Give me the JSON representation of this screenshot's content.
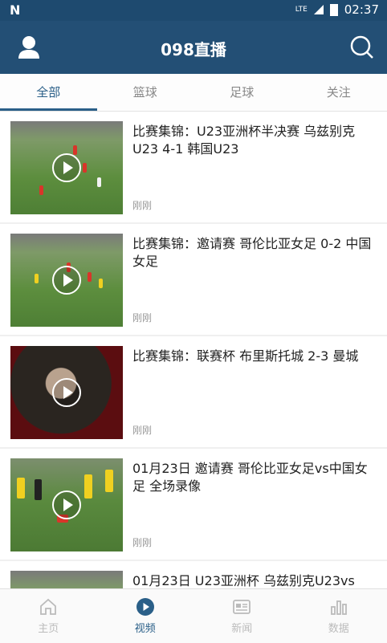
{
  "status": {
    "carrier_icon": "N",
    "network": "LTE",
    "time": "02:37"
  },
  "app": {
    "title": "098直播"
  },
  "tabs": [
    {
      "label": "全部",
      "active": true
    },
    {
      "label": "篮球",
      "active": false
    },
    {
      "label": "足球",
      "active": false
    },
    {
      "label": "关注",
      "active": false
    }
  ],
  "items": [
    {
      "title": "比赛集锦：U23亚洲杯半决赛 乌兹别克U23 4-1 韩国U23",
      "time": "刚刚"
    },
    {
      "title": "比赛集锦：邀请赛 哥伦比亚女足 0-2 中国女足",
      "time": "刚刚"
    },
    {
      "title": "比赛集锦：联赛杯 布里斯托城 2-3 曼城",
      "time": "刚刚"
    },
    {
      "title": "01月23日 邀请赛 哥伦比亚女足vs中国女足 全场录像",
      "time": "刚刚"
    },
    {
      "title": "01月23日 U23亚洲杯 乌兹别克U23vs",
      "time": ""
    }
  ],
  "nav": [
    {
      "label": "主页",
      "icon": "home-icon",
      "active": false
    },
    {
      "label": "视频",
      "icon": "video-play-icon",
      "active": true
    },
    {
      "label": "新闻",
      "icon": "news-icon",
      "active": false
    },
    {
      "label": "数据",
      "icon": "chart-icon",
      "active": false
    }
  ],
  "colors": {
    "primary": "#234f75",
    "accent": "#2a5f88"
  }
}
